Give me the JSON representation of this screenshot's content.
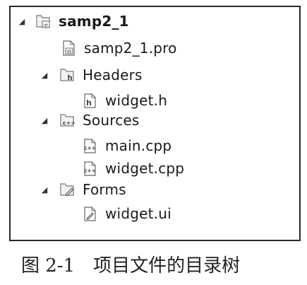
{
  "tree": {
    "project": {
      "label": "samp2_1",
      "icon": "qt-project-folder-icon"
    },
    "pro_file": {
      "label": "samp2_1.pro",
      "icon": "qt-pro-file-icon"
    },
    "headers": {
      "label": "Headers",
      "icon": "headers-folder-icon"
    },
    "widget_h": {
      "label": "widget.h",
      "icon": "header-file-icon"
    },
    "sources": {
      "label": "Sources",
      "icon": "sources-folder-icon"
    },
    "main_cpp": {
      "label": "main.cpp",
      "icon": "cpp-file-icon"
    },
    "widget_cpp": {
      "label": "widget.cpp",
      "icon": "cpp-file-icon"
    },
    "forms": {
      "label": "Forms",
      "icon": "forms-folder-icon"
    },
    "widget_ui": {
      "label": "widget.ui",
      "icon": "ui-file-icon"
    }
  },
  "caption": {
    "number": "图 2-1",
    "text": "项目文件的目录树"
  },
  "colors": {
    "border": "#2a2a2a",
    "text": "#1a1a1a",
    "icon_stroke": "#555555"
  }
}
